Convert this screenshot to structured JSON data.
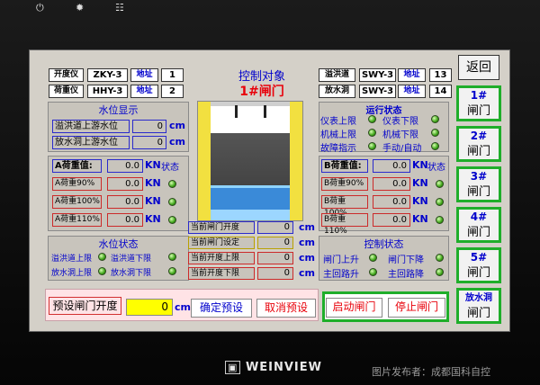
{
  "device": {
    "brand": "WEINVIEW",
    "watermark": "图片发布者：成都国科自控"
  },
  "top_info": {
    "left": [
      {
        "label": "开度仪",
        "model": "ZKY-3",
        "addr_label": "地址",
        "addr": "1"
      },
      {
        "label": "荷重仪",
        "model": "HHY-3",
        "addr_label": "地址",
        "addr": "2"
      }
    ],
    "right": [
      {
        "label": "溢洪道",
        "model": "SWY-3",
        "addr_label": "地址",
        "addr": "13"
      },
      {
        "label": "放水洞",
        "model": "SWY-3",
        "addr_label": "地址",
        "addr": "14"
      }
    ]
  },
  "header": {
    "title": "控制对象",
    "subtitle": "1#闸门"
  },
  "water_level": {
    "title": "水位显示",
    "rows": [
      {
        "label": "溢洪道上游水位",
        "value": "0",
        "unit": "cm"
      },
      {
        "label": "放水洞上游水位",
        "value": "0",
        "unit": "cm"
      }
    ]
  },
  "load_a": {
    "rows": [
      {
        "label": "A荷重值:",
        "value": "0.0",
        "unit": "KN",
        "extra": "状态"
      },
      {
        "label": "A荷重90%",
        "value": "0.0",
        "unit": "KN"
      },
      {
        "label": "A荷重100%",
        "value": "0.0",
        "unit": "KN"
      },
      {
        "label": "A荷重110%",
        "value": "0.0",
        "unit": "KN"
      }
    ]
  },
  "load_b": {
    "rows": [
      {
        "label": "B荷重值:",
        "value": "0.0",
        "unit": "KN",
        "extra": "状态"
      },
      {
        "label": "B荷重90%",
        "value": "0.0",
        "unit": "KN"
      },
      {
        "label": "B荷重100%",
        "value": "0.0",
        "unit": "KN"
      },
      {
        "label": "B荷重110%",
        "value": "0.0",
        "unit": "KN"
      }
    ]
  },
  "run_status": {
    "title": "运行状态",
    "items": [
      "仪表上限",
      "仪表下限",
      "机械上限",
      "机械下限",
      "故障指示",
      "手动/自动"
    ]
  },
  "water_status": {
    "title": "水位状态",
    "items": [
      "溢洪道上限",
      "溢洪道下限",
      "放水洞上限",
      "放水洞下限"
    ]
  },
  "control_status": {
    "title": "控制状态",
    "items": [
      "闸门上升",
      "闸门下降",
      "主回路升",
      "主回路降"
    ]
  },
  "gate_values": {
    "rows": [
      {
        "label": "当前闸门开度",
        "value": "0",
        "unit": "cm"
      },
      {
        "label": "当前闸门设定",
        "value": "0",
        "unit": "cm"
      },
      {
        "label": "当前开度上限",
        "value": "0",
        "unit": "cm"
      },
      {
        "label": "当前开度下限",
        "value": "0",
        "unit": "cm"
      }
    ]
  },
  "preset": {
    "label": "预设闸门开度",
    "value": "0",
    "unit": "cm",
    "confirm": "确定预设",
    "cancel": "取消预设"
  },
  "actions": {
    "start": "启动闸门",
    "stop": "停止闸门"
  },
  "sidebar": {
    "back": "返回",
    "gates": [
      {
        "line1": "1#",
        "line2": "闸门"
      },
      {
        "line1": "2#",
        "line2": "闸门"
      },
      {
        "line1": "3#",
        "line2": "闸门"
      },
      {
        "line1": "4#",
        "line2": "闸门"
      },
      {
        "line1": "5#",
        "line2": "闸门"
      },
      {
        "line1": "放水洞",
        "line2": "闸门"
      }
    ]
  }
}
